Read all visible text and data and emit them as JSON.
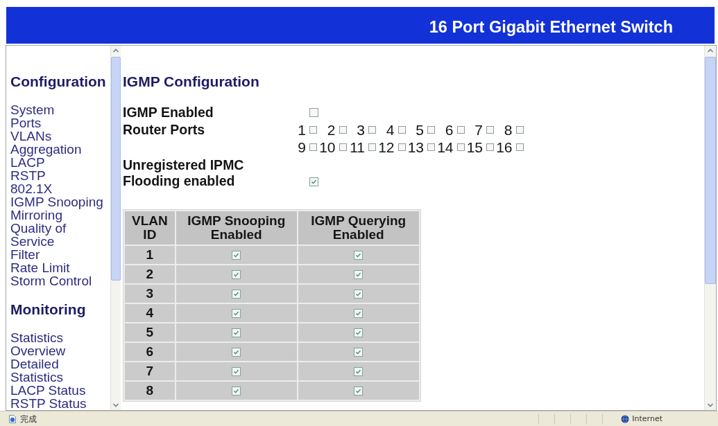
{
  "banner": {
    "title": "16 Port Gigabit Ethernet Switch"
  },
  "sidebar": {
    "sections": [
      {
        "heading": "Configuration",
        "items": [
          "System",
          "Ports",
          "VLANs",
          "Aggregation",
          "LACP",
          "RSTP",
          "802.1X",
          "IGMP Snooping",
          "Mirroring",
          "Quality of Service",
          "Filter",
          "Rate Limit",
          "Storm Control"
        ]
      },
      {
        "heading": "Monitoring",
        "items": [
          "Statistics Overview",
          "Detailed Statistics",
          "LACP Status",
          "RSTP Status"
        ]
      }
    ]
  },
  "igmp_configuration": {
    "title": "IGMP Configuration",
    "igmp_enabled": {
      "label": "IGMP Enabled",
      "checked": false
    },
    "router_ports": {
      "label": "Router Ports",
      "ports": [
        {
          "label": "1",
          "checked": false
        },
        {
          "label": "2",
          "checked": false
        },
        {
          "label": "3",
          "checked": false
        },
        {
          "label": "4",
          "checked": false
        },
        {
          "label": "5",
          "checked": false
        },
        {
          "label": "6",
          "checked": false
        },
        {
          "label": "7",
          "checked": false
        },
        {
          "label": "8",
          "checked": false
        },
        {
          "label": "9",
          "checked": false
        },
        {
          "label": "10",
          "checked": false
        },
        {
          "label": "11",
          "checked": false
        },
        {
          "label": "12",
          "checked": false
        },
        {
          "label": "13",
          "checked": false
        },
        {
          "label": "14",
          "checked": false
        },
        {
          "label": "15",
          "checked": false
        },
        {
          "label": "16",
          "checked": false
        }
      ]
    },
    "unregistered_ipmc_flooding": {
      "label": "Unregistered IPMC Flooding enabled",
      "checked": true
    }
  },
  "vlan_table": {
    "columns": [
      "VLAN ID",
      "IGMP Snooping Enabled",
      "IGMP Querying Enabled"
    ],
    "rows": [
      {
        "vlan_id": "1",
        "snooping_enabled": true,
        "querying_enabled": true
      },
      {
        "vlan_id": "2",
        "snooping_enabled": true,
        "querying_enabled": true
      },
      {
        "vlan_id": "3",
        "snooping_enabled": true,
        "querying_enabled": true
      },
      {
        "vlan_id": "4",
        "snooping_enabled": true,
        "querying_enabled": true
      },
      {
        "vlan_id": "5",
        "snooping_enabled": true,
        "querying_enabled": true
      },
      {
        "vlan_id": "6",
        "snooping_enabled": true,
        "querying_enabled": true
      },
      {
        "vlan_id": "7",
        "snooping_enabled": true,
        "querying_enabled": true
      },
      {
        "vlan_id": "8",
        "snooping_enabled": true,
        "querying_enabled": true
      }
    ]
  },
  "status_bar": {
    "text": "完成",
    "zone": "Internet"
  }
}
